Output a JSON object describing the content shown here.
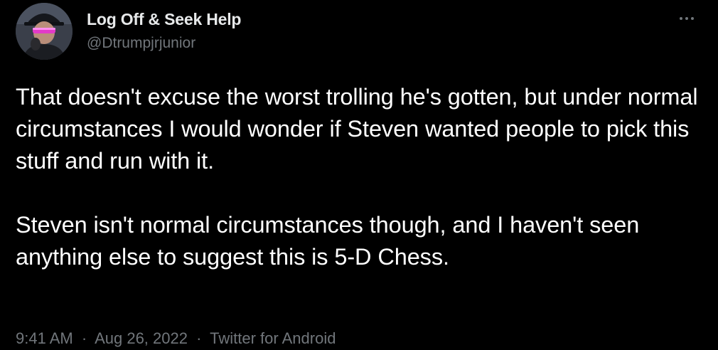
{
  "author": {
    "display_name": "Log Off & Seek Help",
    "handle": "@Dtrumpjrjunior",
    "avatar_icon": "user-avatar-with-pink-visor-and-hat"
  },
  "tweet": {
    "paragraphs": [
      "That doesn't excuse the worst trolling he's gotten, but under normal circumstances I would wonder if Steven wanted people to pick this stuff and run with it.",
      "Steven isn't normal circumstances though, and I haven't seen anything else to suggest this is 5-D Chess."
    ],
    "time": "9:41 AM",
    "date": "Aug 26, 2022",
    "source": "Twitter for Android",
    "separator": "·"
  },
  "icons": {
    "more": "more-options-icon"
  },
  "colors": {
    "background": "#000000",
    "text_primary": "#ffffff",
    "text_secondary": "#71767b"
  }
}
